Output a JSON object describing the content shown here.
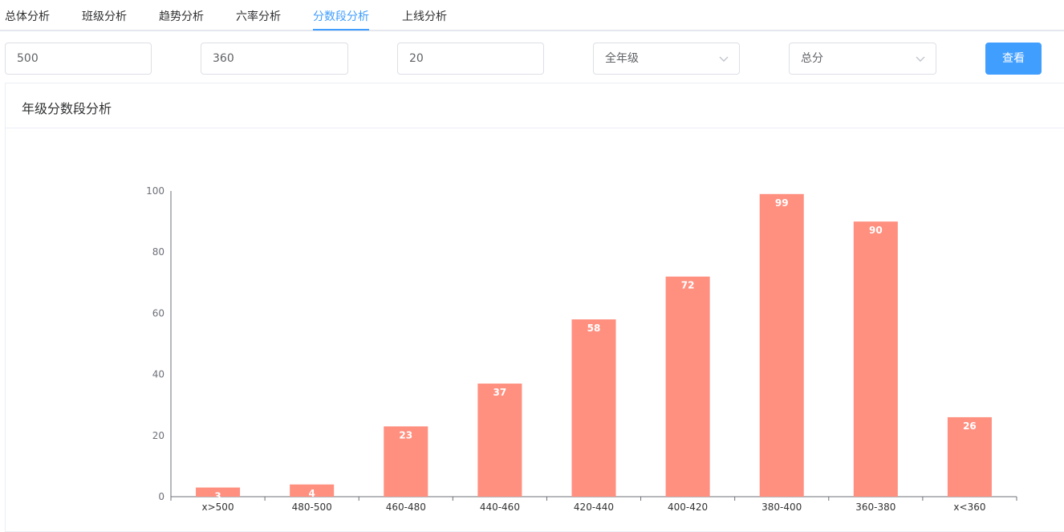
{
  "tabs": [
    {
      "label": "总体分析",
      "active": false
    },
    {
      "label": "班级分析",
      "active": false
    },
    {
      "label": "趋势分析",
      "active": false
    },
    {
      "label": "六率分析",
      "active": false
    },
    {
      "label": "分数段分析",
      "active": true
    },
    {
      "label": "上线分析",
      "active": false
    }
  ],
  "filters": {
    "upper_score": "500",
    "lower_score": "360",
    "interval": "20",
    "grade_select": "全年级",
    "subject_select": "总分",
    "view_button": "查看"
  },
  "card": {
    "title": "年级分数段分析"
  },
  "colors": {
    "accent": "#409eff",
    "bar": "#ff9080"
  },
  "icons": {
    "select_arrow": "chevron-down-icon"
  },
  "chart_data": {
    "type": "bar",
    "categories": [
      "x>500",
      "480-500",
      "460-480",
      "440-460",
      "420-440",
      "400-420",
      "380-400",
      "360-380",
      "x<360"
    ],
    "values": [
      3,
      4,
      23,
      37,
      58,
      72,
      99,
      90,
      26
    ],
    "ylim": [
      0,
      100
    ],
    "yticks": [
      0,
      20,
      40,
      60,
      80,
      100
    ],
    "grid": false,
    "data_labels": true
  }
}
